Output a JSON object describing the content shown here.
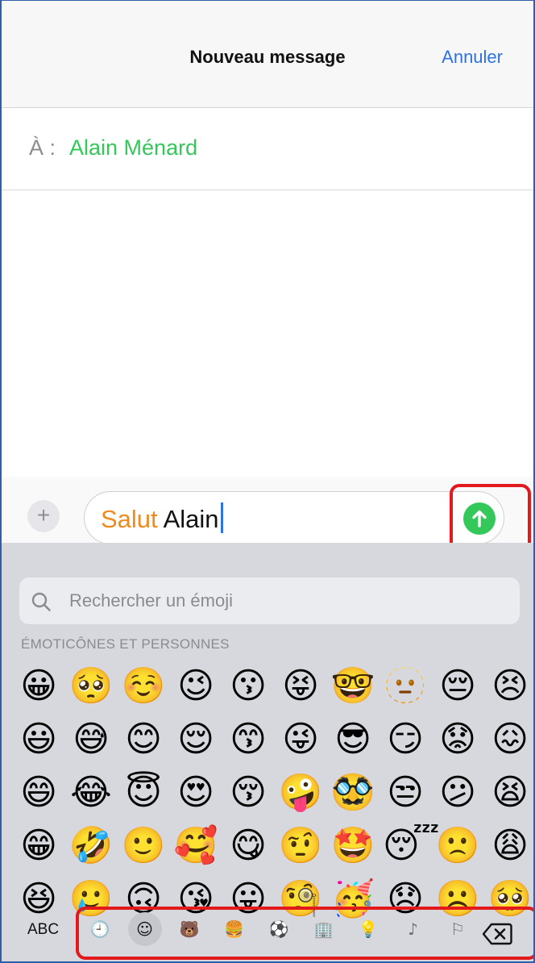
{
  "header": {
    "title": "Nouveau message",
    "cancel_label": "Annuler"
  },
  "recipient": {
    "label": "À :",
    "name": "Alain Ménard"
  },
  "composer": {
    "plus_label": "+",
    "text_highlight": "Salut",
    "text_rest": " Alain"
  },
  "keyboard": {
    "search_placeholder": "Rechercher un émoji",
    "category_label": "ÉMOTICÔNES ET PERSONNES",
    "abc_label": "ABC",
    "emoji_rows": [
      [
        "😀",
        "🥺",
        "☺️",
        "😉",
        "😗",
        "😝",
        "🤓",
        "🫥",
        "😔",
        "😣"
      ],
      [
        "😃",
        "😅",
        "😊",
        "😌",
        "😙",
        "😜",
        "😎",
        "😏",
        "😟",
        "😖"
      ],
      [
        "😄",
        "😂",
        "😇",
        "😍",
        "😚",
        "🤪",
        "🥸",
        "😒",
        "😕",
        "😫"
      ],
      [
        "😁",
        "🤣",
        "🙂",
        "🥰",
        "😋",
        "🤨",
        "🤩",
        "😴",
        "🙁",
        "😩"
      ],
      [
        "😆",
        "🥲",
        "🙃",
        "😘",
        "😛",
        "🧐",
        "🥳",
        "😞",
        "☹️",
        "🥺"
      ]
    ],
    "categories": [
      {
        "name": "recent",
        "glyph": "🕘"
      },
      {
        "name": "smileys",
        "glyph": "☺"
      },
      {
        "name": "animals",
        "glyph": "🐻"
      },
      {
        "name": "food",
        "glyph": "🍔"
      },
      {
        "name": "activity",
        "glyph": "⚽"
      },
      {
        "name": "travel",
        "glyph": "🏢"
      },
      {
        "name": "objects",
        "glyph": "💡"
      },
      {
        "name": "symbols",
        "glyph": "♪"
      },
      {
        "name": "flags",
        "glyph": "⚐"
      }
    ]
  },
  "colors": {
    "accent_blue": "#2e72e6",
    "recipient_green": "#34c759",
    "highlight_orange": "#f08a1c",
    "annotation_red": "#e3191c"
  }
}
